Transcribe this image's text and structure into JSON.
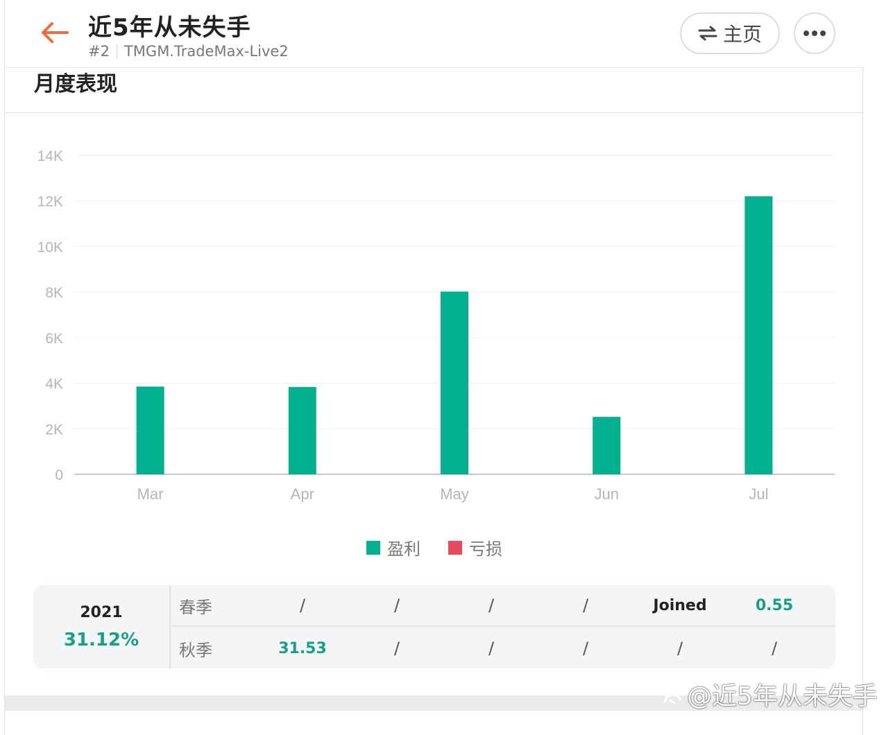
{
  "header": {
    "title": "近5年从未失手",
    "rank": "#2",
    "account": "TMGM.TradeMax-Live2",
    "home_label": "主页"
  },
  "section": {
    "title": "月度表现"
  },
  "chart_data": {
    "type": "bar",
    "categories": [
      "Mar",
      "Apr",
      "May",
      "Jun",
      "Jul"
    ],
    "series": [
      {
        "name": "盈利",
        "color": "#00b08f",
        "values": [
          3850,
          3830,
          8020,
          2520,
          12200
        ]
      },
      {
        "name": "亏损",
        "color": "#e84a5f",
        "values": [
          0,
          0,
          0,
          0,
          0
        ]
      }
    ],
    "yticks": [
      "0",
      "2K",
      "4K",
      "6K",
      "8K",
      "10K",
      "12K",
      "14K"
    ],
    "ylim": [
      0,
      14000
    ],
    "grid": true,
    "legend": "bottom-center"
  },
  "legend": {
    "profit": "盈利",
    "loss": "亏损",
    "profit_color": "#00b08f",
    "loss_color": "#e84a5f"
  },
  "stats": {
    "year": "2021",
    "year_return": "31.12%",
    "rows": [
      {
        "label": "春季",
        "cells": [
          "/",
          "/",
          "/",
          "/",
          "Joined",
          "0.55"
        ]
      },
      {
        "label": "秋季",
        "cells": [
          "31.53",
          "/",
          "/",
          "/",
          "/",
          "/"
        ]
      }
    ]
  },
  "watermark": "@近5年从未失手"
}
